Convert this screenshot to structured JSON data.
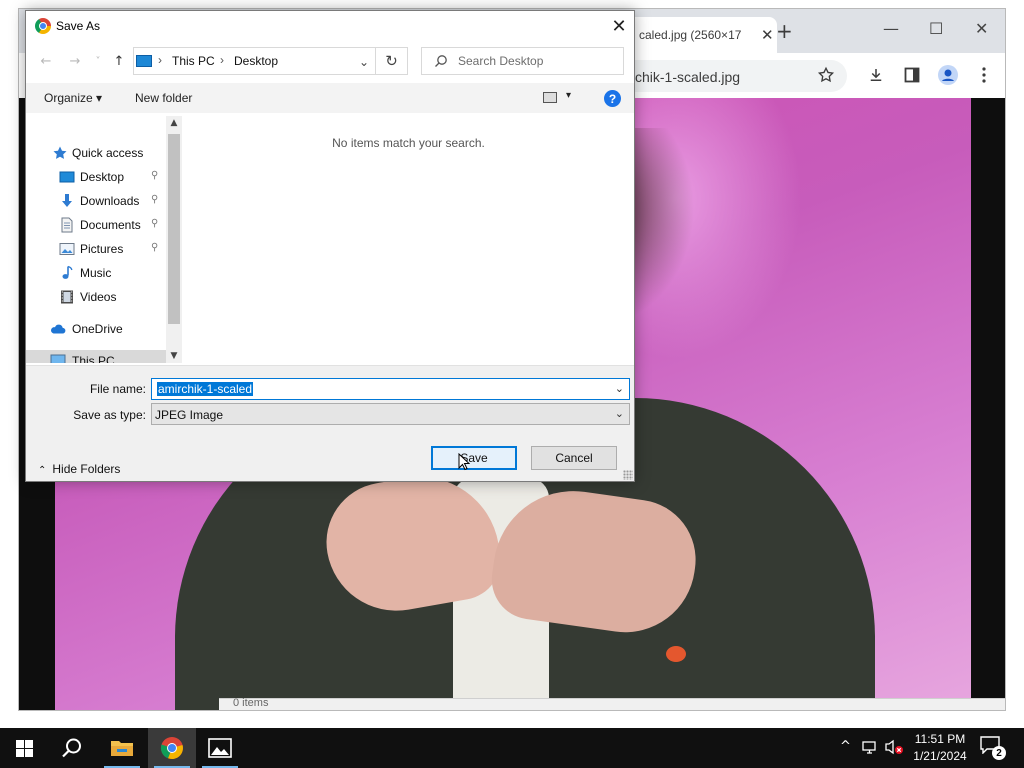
{
  "browser": {
    "tab_title": "caled.jpg (2560×17",
    "tab_close": "✕",
    "new_tab": "+",
    "omnibox_text": "chik-1-scaled.jpg",
    "status_text": "0 items"
  },
  "dialog": {
    "title": "Save As",
    "close": "✕",
    "nav": {
      "back": "←",
      "forward": "→",
      "recent": "˅",
      "up": "↑"
    },
    "breadcrumb": [
      "This PC",
      "Desktop"
    ],
    "breadcrumb_sep": "›",
    "address_dropdown": "⌄",
    "refresh": "↻",
    "search_placeholder": "Search Desktop",
    "commands": {
      "organize": "Organize ▾",
      "new_folder": "New folder",
      "view_dropdown": "▾",
      "help": "?"
    },
    "nav_items": [
      {
        "label": "Quick access",
        "icon": "star-icon",
        "pinned": false
      },
      {
        "label": "Desktop",
        "icon": "desktop-icon",
        "pinned": true
      },
      {
        "label": "Downloads",
        "icon": "download-icon",
        "pinned": true
      },
      {
        "label": "Documents",
        "icon": "document-icon",
        "pinned": true
      },
      {
        "label": "Pictures",
        "icon": "pictures-icon",
        "pinned": true
      },
      {
        "label": "Music",
        "icon": "music-icon",
        "pinned": false
      },
      {
        "label": "Videos",
        "icon": "video-icon",
        "pinned": false
      },
      {
        "label": "OneDrive",
        "icon": "cloud-icon",
        "pinned": false
      },
      {
        "label": "This PC",
        "icon": "computer-icon",
        "pinned": false,
        "selected": true
      }
    ],
    "pin_glyph": "📌",
    "scroll": {
      "up": "▲",
      "down": "▼"
    },
    "empty_message": "No items match your search.",
    "file_name_label": "File name:",
    "file_name_value": "amirchik-1-scaled",
    "save_as_type_label": "Save as type:",
    "save_as_type_value": "JPEG Image",
    "dropdown_glyph": "⌄",
    "hide_folders": "Hide Folders",
    "hide_folders_chevron": "⌃",
    "save_button": "Save",
    "cancel_button": "Cancel"
  },
  "taskbar": {
    "time": "11:51 PM",
    "date": "1/21/2024",
    "notification_count": "2",
    "tray_chevron": "^"
  },
  "colors": {
    "accent": "#0078d7",
    "taskbar": "#101010",
    "photo_pink": "#d24fb2"
  }
}
